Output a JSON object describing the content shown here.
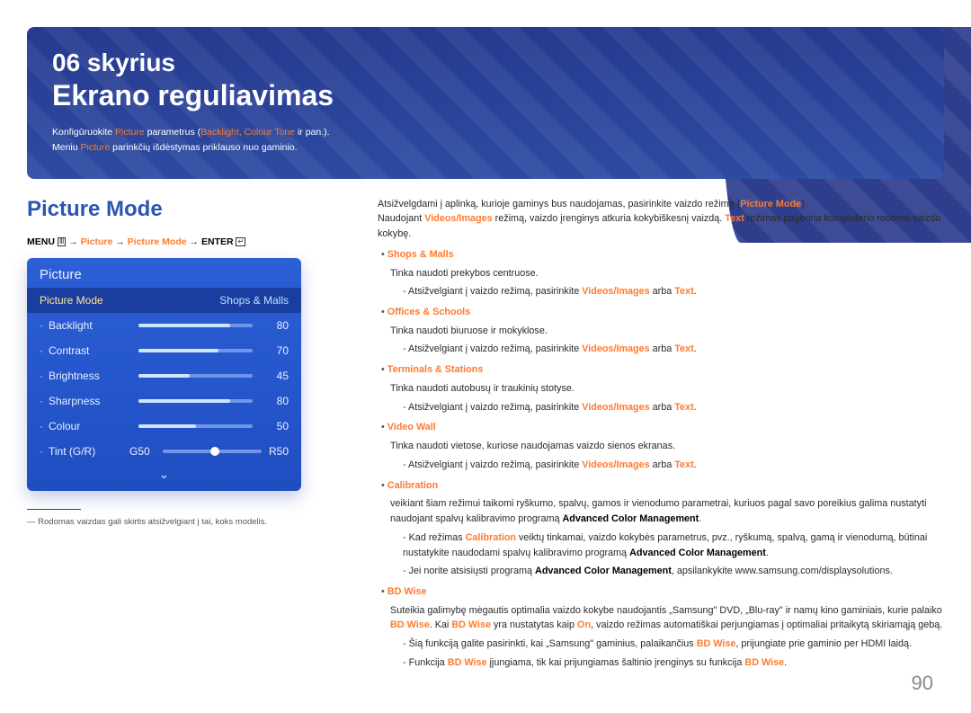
{
  "chapter": {
    "num": "06 skyrius",
    "title": "Ekrano reguliavimas",
    "intro_pre": "Konfigūruokite ",
    "intro_pic": "Picture",
    "intro_mid": " parametrus (",
    "intro_opts": "Backlight, Colour Tone",
    "intro_end": " ir pan.).",
    "intro2_pre": "Meniu ",
    "intro2_pic": "Picture",
    "intro2_end": " parinkčių išdėstymas priklauso nuo gaminio."
  },
  "section_title": "Picture Mode",
  "menubar": {
    "menu": "MENU",
    "path_pic": "Picture",
    "path_mode": "Picture Mode",
    "enter": "ENTER"
  },
  "panel": {
    "title": "Picture",
    "mode_label": "Picture Mode",
    "mode_value": "Shops & Malls",
    "rows": [
      {
        "label": "Backlight",
        "value": 80
      },
      {
        "label": "Contrast",
        "value": 70
      },
      {
        "label": "Brightness",
        "value": 45
      },
      {
        "label": "Sharpness",
        "value": 80
      },
      {
        "label": "Colour",
        "value": 50
      }
    ],
    "tint": {
      "label": "Tint (G/R)",
      "g": "G50",
      "r": "R50"
    }
  },
  "footnote": "Rodomas vaizdas gali skirtis atsižvelgiant į tai, koks modelis.",
  "right": {
    "lead_pre": "Atsižvelgdami į aplinką, kurioje gaminys bus naudojamas, pasirinkite vaizdo režimą (",
    "lead_pm": "Picture Mode",
    "lead_post": ").",
    "lead2_a": "Naudojant ",
    "lead2_vi": "Videos/Images",
    "lead2_b": " režimą, vaizdo įrenginys atkuria kokybiškesnį vaizdą. ",
    "lead2_t": "Text",
    "lead2_c": " režimas pagerina kompiuterio rodomo vaizdo kokybę.",
    "common_note_pre": "Atsižvelgiant į vaizdo režimą, pasirinkite ",
    "common_note_vi": "Videos/Images",
    "common_note_mid": " arba ",
    "common_note_tx": "Text",
    "items": {
      "shops": {
        "title": "Shops & Malls",
        "desc": "Tinka naudoti prekybos centruose."
      },
      "offices": {
        "title": "Offices & Schools",
        "desc": "Tinka naudoti biuruose ir mokyklose."
      },
      "terminals": {
        "title": "Terminals & Stations",
        "desc": "Tinka naudoti autobusų ir traukinių stotyse."
      },
      "videowall": {
        "title": "Video Wall",
        "desc": "Tinka naudoti vietose, kuriose naudojamas vaizdo sienos ekranas."
      },
      "calib": {
        "title": "Calibration",
        "desc_a": "veikiant šiam režimui taikomi ryškumo, spalvų, gamos ir vienodumo parametrai, kuriuos pagal savo poreikius galima nustatyti naudojant spalvų kalibravimo programą ",
        "acm": "Advanced Color Management",
        "note1_a": "Kad režimas ",
        "note1_b": " veiktų tinkamai, vaizdo kokybės parametrus, pvz., ryškumą, spalvą, gamą ir vienodumą, būtinai nustatykite naudodami spalvų kalibravimo programą ",
        "note2_a": "Jei norite atsisiųsti programą ",
        "note2_b": ", apsilankykite www.samsung.com/displaysolutions."
      },
      "bdwise": {
        "title": "BD Wise",
        "desc_a": "Suteikia galimybę mėgautis optimalia vaizdo kokybe naudojantis „Samsung\" DVD, „Blu-ray\" ir namų kino gaminiais, kurie palaiko ",
        "bd": "BD Wise",
        "desc_b": ". Kai ",
        "desc_c": " yra nustatytas kaip ",
        "on": "On",
        "desc_d": ", vaizdo režimas automatiškai perjungiamas į optimaliai pritaikytą skiriamąją gebą.",
        "n1_a": "Šią funkciją galite pasirinkti, kai „Samsung\" gaminius, palaikančius ",
        "n1_b": ", prijungiate prie gaminio per HDMI laidą.",
        "n2_a": "Funkcija ",
        "n2_b": " įjungiama, tik kai prijungiamas šaltinio įrenginys su funkcija "
      }
    }
  },
  "page_number": "90"
}
